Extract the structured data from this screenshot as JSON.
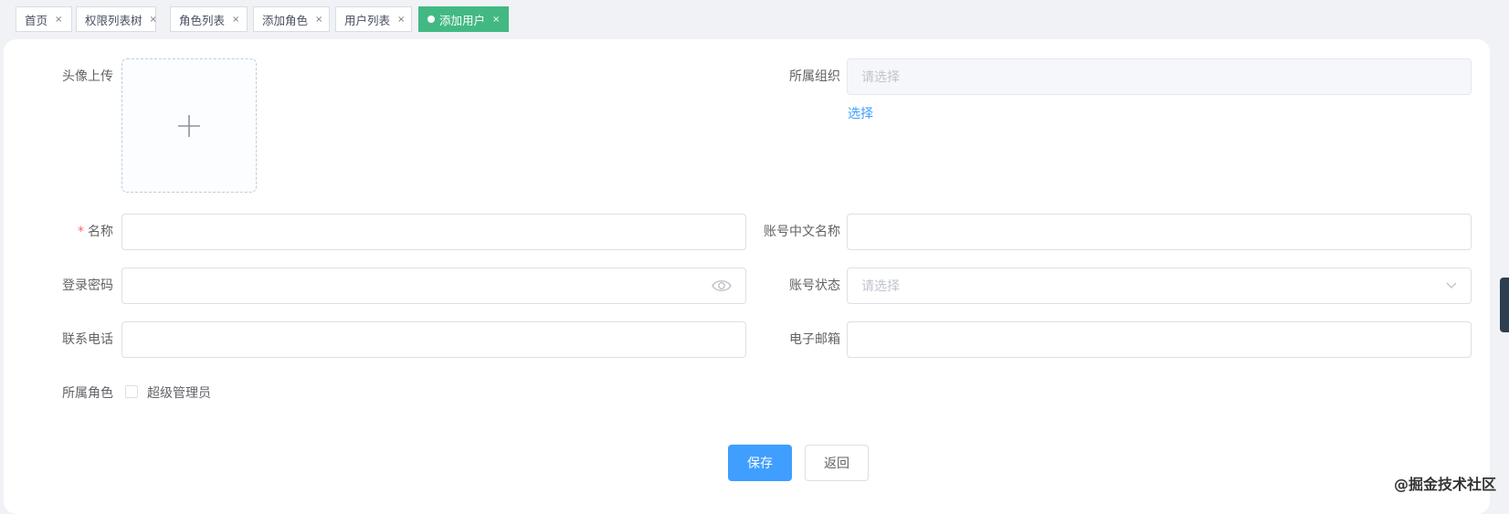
{
  "tabs": [
    {
      "label": "首页",
      "active": false
    },
    {
      "label": "权限列表树",
      "active": false
    },
    {
      "label": "角色列表",
      "active": false
    },
    {
      "label": "添加角色",
      "active": false
    },
    {
      "label": "用户列表",
      "active": false
    },
    {
      "label": "添加用户",
      "active": true
    }
  ],
  "close_glyph": "×",
  "form": {
    "avatar_label": "头像上传",
    "org_label": "所属组织",
    "org_placeholder": "请选择",
    "org_select_link": "选择",
    "name_required_mark": "*",
    "name_label": "名称",
    "cn_name_label": "账号中文名称",
    "password_label": "登录密码",
    "status_label": "账号状态",
    "status_placeholder": "请选择",
    "phone_label": "联系电话",
    "email_label": "电子邮箱",
    "role_label": "所属角色",
    "role_option": "超级管理员"
  },
  "buttons": {
    "save": "保存",
    "back": "返回"
  },
  "watermark": "@掘金技术社区",
  "colors": {
    "active_tab": "#42b983",
    "primary": "#409eff",
    "required": "#f56c6c"
  }
}
